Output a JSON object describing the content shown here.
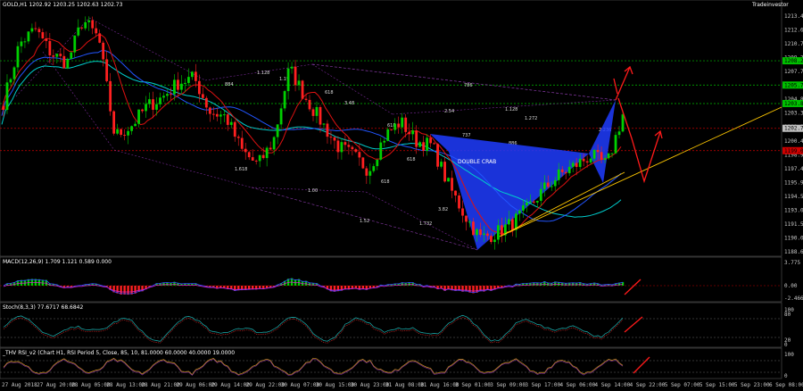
{
  "header": {
    "main": "GOLD,H1  1202.92 1203.25 1202.63 1202.73",
    "macd": "MACD(12,26,9) 1.709 1.121 0.589 0.000",
    "stoch": "Stoch(8,3,3) 77.6717 68.6842",
    "rsi": "_THV RSI_v2  (Chart H1, RSI Period 5, Close, 85, 10, 81.0000 60.0000 40.0000 19.0000",
    "brand": "Tradeinvestor"
  },
  "pattern_label": "DOUBLE CRAB",
  "fib_labels": [
    "1.128",
    "1.19",
    "884",
    "618",
    "3.48",
    "786",
    "2.54",
    "1.128",
    "1.272",
    "618",
    "737",
    "886",
    "2.236",
    "1.618",
    "1.00",
    "618",
    "1.52",
    "1.732",
    "3.82",
    "618"
  ],
  "price_scale": [
    "1213.40",
    "1212.65",
    "1210.70",
    "1209.25",
    "1207.75",
    "1206.30",
    "1204.80",
    "1203.35",
    "1201.85",
    "1200.40",
    "1198.90",
    "1197.40",
    "1195.95",
    "1194.50",
    "1193.00",
    "1191.55",
    "1190.05",
    "1188.60"
  ],
  "price_badges": [
    {
      "text": "1208.25",
      "color": "#00c000"
    },
    {
      "text": "1205.75",
      "color": "#00c000"
    },
    {
      "text": "1203.85",
      "color": "#00c000"
    },
    {
      "text": "1202.73",
      "color": "#c0c0c0"
    },
    {
      "text": "1199.00",
      "color": "#d00000"
    }
  ],
  "macd_scale": [
    "3.775",
    "0.00",
    "-2.466"
  ],
  "stoch_scale": [
    "100",
    "80",
    "20",
    "0"
  ],
  "rsi_scale": [
    "100",
    "0"
  ],
  "time_axis": [
    "27 Aug 2018",
    "27 Aug 20:00",
    "28 Aug 05:00",
    "28 Aug 13:00",
    "28 Aug 21:00",
    "29 Aug 06:00",
    "29 Aug 14:00",
    "29 Aug 22:00",
    "30 Aug 07:00",
    "30 Aug 15:00",
    "30 Aug 23:00",
    "31 Aug 08:00",
    "31 Aug 16:00",
    "3 Sep 01:00",
    "3 Sep 09:00",
    "3 Sep 17:00",
    "4 Sep 06:00",
    "4 Sep 14:00",
    "4 Sep 22:00",
    "5 Sep 07:00",
    "5 Sep 15:00",
    "5 Sep 23:00",
    "6 Sep 08:00"
  ],
  "colors": {
    "bull": "#00d000",
    "bear": "#ff2020",
    "ma_fast": "#dd1111",
    "ma_mid": "#2255ff",
    "ma_slow": "#00cccc",
    "pattern": "#1f3cff",
    "trend": "#ffc800",
    "projection": "#ff1a1a"
  },
  "chart_data": [
    {
      "type": "candlestick",
      "title": "GOLD,H1",
      "ylim": [
        1188.6,
        1213.4
      ],
      "last": {
        "open": 1202.92,
        "high": 1203.25,
        "low": 1202.63,
        "close": 1202.73
      },
      "horizontal_levels": [
        1208.25,
        1205.75,
        1203.85,
        1201.3,
        1199.0
      ],
      "close_path": [
        1204,
        1210,
        1211.5,
        1209,
        1208,
        1212.5,
        1210.5,
        1200.5,
        1201.5,
        1203.5,
        1204.5,
        1206,
        1206.5,
        1203,
        1202.5,
        1199,
        1197.5,
        1200,
        1207.5,
        1204.5,
        1202,
        1199.5,
        1198.5,
        1197,
        1200.5,
        1202,
        1200,
        1199.5,
        1195.5,
        1192.5,
        1190,
        1190.5,
        1191.5,
        1193,
        1195,
        1196.5,
        1197.5,
        1198.5,
        1197.5,
        1202.73
      ]
    },
    {
      "type": "bar",
      "title": "MACD(12,26,9)",
      "values": {
        "macd": 1.709,
        "signal": 1.121,
        "histogram": 0.589
      },
      "ylim": [
        -2.466,
        3.775
      ]
    },
    {
      "type": "line",
      "title": "Stoch(8,3,3)",
      "series": [
        {
          "name": "%K",
          "values": [
            77.6717
          ]
        },
        {
          "name": "%D",
          "values": [
            68.6842
          ]
        }
      ],
      "levels": [
        80,
        20
      ],
      "ylim": [
        0,
        100
      ]
    },
    {
      "type": "line",
      "title": "_THV RSI_v2",
      "period": 5,
      "levels": [
        81,
        60,
        40,
        19
      ],
      "ylim": [
        0,
        100
      ]
    }
  ]
}
